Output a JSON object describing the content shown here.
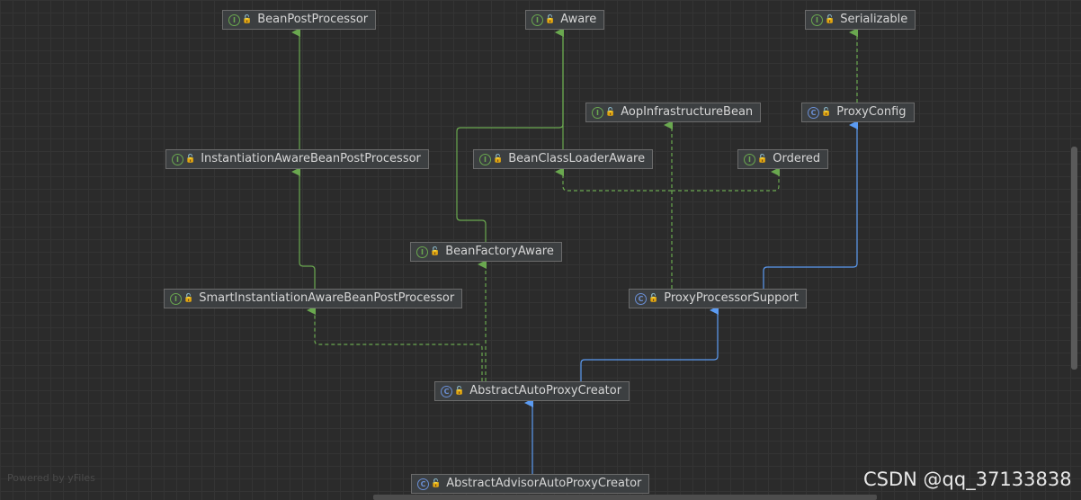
{
  "diagram": {
    "nodes": [
      {
        "id": "bpp",
        "name": "BeanPostProcessor",
        "kind": "interface"
      },
      {
        "id": "aware",
        "name": "Aware",
        "kind": "interface"
      },
      {
        "id": "ser",
        "name": "Serializable",
        "kind": "interface"
      },
      {
        "id": "aib",
        "name": "AopInfrastructureBean",
        "kind": "interface"
      },
      {
        "id": "pc",
        "name": "ProxyConfig",
        "kind": "class"
      },
      {
        "id": "iabpp",
        "name": "InstantiationAwareBeanPostProcessor",
        "kind": "interface"
      },
      {
        "id": "bcla",
        "name": "BeanClassLoaderAware",
        "kind": "interface"
      },
      {
        "id": "ord",
        "name": "Ordered",
        "kind": "interface"
      },
      {
        "id": "bfa",
        "name": "BeanFactoryAware",
        "kind": "interface"
      },
      {
        "id": "siabpp",
        "name": "SmartInstantiationAwareBeanPostProcessor",
        "kind": "interface"
      },
      {
        "id": "pps",
        "name": "ProxyProcessorSupport",
        "kind": "class"
      },
      {
        "id": "aapc",
        "name": "AbstractAutoProxyCreator",
        "kind": "class"
      },
      {
        "id": "aaapc",
        "name": "AbstractAdvisorAutoProxyCreator",
        "kind": "class"
      }
    ],
    "edges": [
      {
        "from": "iabpp",
        "to": "bpp",
        "type": "extends"
      },
      {
        "from": "siabpp",
        "to": "iabpp",
        "type": "extends"
      },
      {
        "from": "bcla",
        "to": "aware",
        "type": "extends"
      },
      {
        "from": "bfa",
        "to": "aware",
        "type": "extends"
      },
      {
        "from": "pc",
        "to": "ser",
        "type": "implements"
      },
      {
        "from": "pps",
        "to": "pc",
        "type": "extends-class"
      },
      {
        "from": "pps",
        "to": "aib",
        "type": "implements"
      },
      {
        "from": "pps",
        "to": "bcla",
        "type": "implements"
      },
      {
        "from": "pps",
        "to": "ord",
        "type": "implements"
      },
      {
        "from": "aapc",
        "to": "pps",
        "type": "extends-class"
      },
      {
        "from": "aapc",
        "to": "siabpp",
        "type": "implements"
      },
      {
        "from": "aapc",
        "to": "bfa",
        "type": "implements"
      },
      {
        "from": "aaapc",
        "to": "aapc",
        "type": "extends-class"
      }
    ],
    "colors": {
      "interface_edge": "#6aa84f",
      "class_edge": "#5b9bf2"
    },
    "kind_glyphs": {
      "interface": "I",
      "class": "C"
    },
    "lock_icon": "🔓"
  },
  "footer": {
    "powered_by": "Powered by yFiles",
    "watermark": "CSDN @qq_37133838"
  }
}
